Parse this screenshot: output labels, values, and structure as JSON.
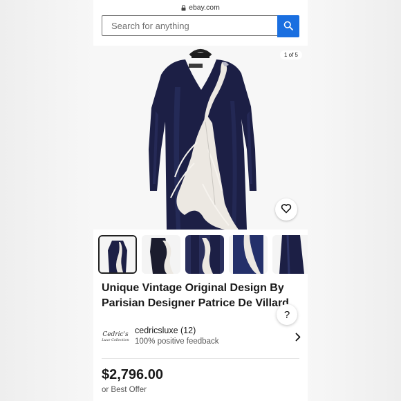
{
  "browser": {
    "domain": "ebay.com"
  },
  "search": {
    "placeholder": "Search for anything"
  },
  "gallery": {
    "counter": "1 of 5"
  },
  "listing": {
    "title_line1": "Unique Vintage Original Design By",
    "title_line2": "Parisian Designer Patrice De Villard"
  },
  "seller": {
    "logo_line1": "Cedric's",
    "logo_line2": "Luxe Collection",
    "name": "cedricsluxe (12)",
    "feedback": "100% positive feedback"
  },
  "price": {
    "amount": "$2,796.00",
    "format": "or Best Offer"
  },
  "help_label": "?",
  "colors": {
    "accent": "#1a6fe0",
    "dress": "#1c1f45",
    "feather": "#ece8e2"
  },
  "icons": [
    "lock-icon",
    "search-icon",
    "heart-icon",
    "chevron-right-icon"
  ]
}
